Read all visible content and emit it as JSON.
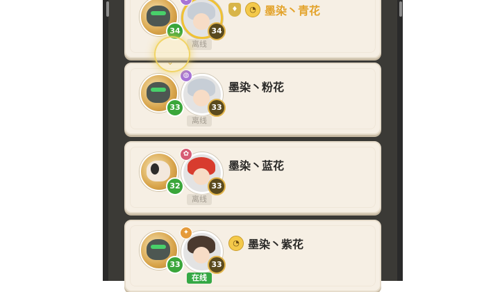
{
  "friends": [
    {
      "name": "墨染丶青花",
      "pet_level": "34",
      "char_level": "34",
      "status": "离线",
      "has_badge": true,
      "badge_glyph": "♦",
      "emoji": "◔",
      "element": "♁",
      "highlighted_name": true
    },
    {
      "name": "墨染丶粉花",
      "pet_level": "33",
      "char_level": "33",
      "status": "离线",
      "element": "◍"
    },
    {
      "name": "墨染丶蓝花",
      "pet_level": "32",
      "char_level": "33",
      "status": "离线",
      "element": "✿"
    },
    {
      "name": "墨染丶紫花",
      "pet_level": "33",
      "char_level": "33",
      "status": "在线",
      "emoji": "◔",
      "element": "✦"
    }
  ],
  "colors": {
    "card_bg": "#f6efe4",
    "gold_name": "#e3a32b",
    "online": "#35a845",
    "level_green": "#3aa63a"
  }
}
